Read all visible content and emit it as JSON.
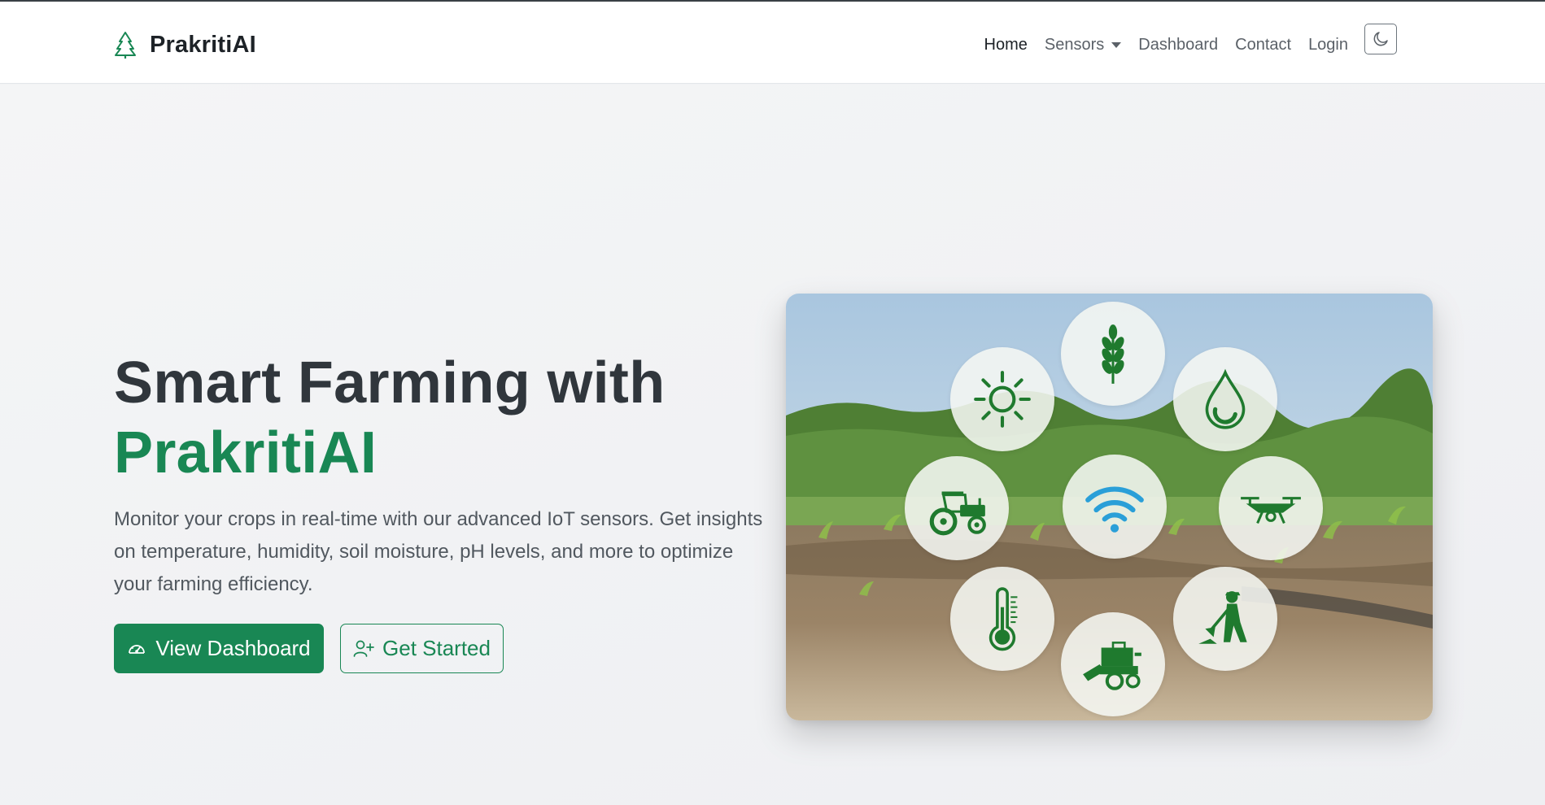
{
  "brand": {
    "name": "PrakritiAI"
  },
  "nav": {
    "home": "Home",
    "sensors": "Sensors",
    "dashboard": "Dashboard",
    "contact": "Contact",
    "login": "Login"
  },
  "hero": {
    "title_line1": "Smart Farming with",
    "title_line2": "PrakritiAI",
    "description": "Monitor your crops in real-time with our advanced IoT sensors. Get insights on temperature, humidity, soil moisture, pH levels, and more to optimize your farming efficiency.",
    "primary_button": "View Dashboard",
    "secondary_button": "Get Started"
  },
  "icons": {
    "brand": "tree-icon",
    "theme": "moon-icon",
    "primary_button": "speedometer-icon",
    "secondary_button": "person-plus-icon",
    "illustration": [
      "sun-icon",
      "wheat-icon",
      "water-drop-icon",
      "tractor-icon",
      "wifi-icon",
      "drone-icon",
      "thermometer-icon",
      "harvester-icon",
      "farmer-icon"
    ]
  },
  "colors": {
    "accent": "#198754",
    "icon_green": "#1f7a2e",
    "wifi_blue": "#2a9fd8",
    "title": "#30363c"
  }
}
